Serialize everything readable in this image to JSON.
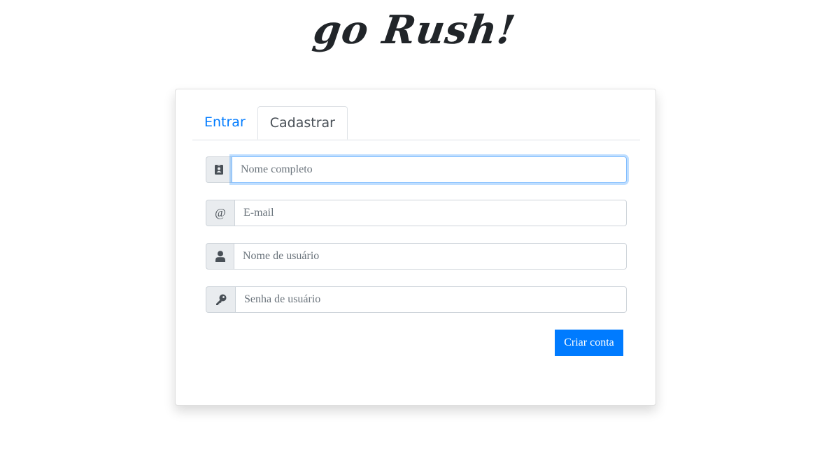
{
  "brand": {
    "logo_text": "go Rush!"
  },
  "tabs": [
    {
      "label": "Entrar",
      "active": false
    },
    {
      "label": "Cadastrar",
      "active": true
    }
  ],
  "form": {
    "fields": [
      {
        "icon": "address-card-icon",
        "placeholder": "Nome completo",
        "value": "",
        "focused": true
      },
      {
        "icon": "at-sign-icon",
        "addon_text": "@",
        "placeholder": "E-mail",
        "value": ""
      },
      {
        "icon": "user-icon",
        "placeholder": "Nome de usuário",
        "value": ""
      },
      {
        "icon": "key-icon",
        "placeholder": "Senha de usuário",
        "value": ""
      }
    ],
    "submit_label": "Criar conta"
  },
  "colors": {
    "primary": "#007bff",
    "addon_bg": "#e9ecef",
    "border": "#ced4da",
    "focus_border": "#80bdff"
  }
}
